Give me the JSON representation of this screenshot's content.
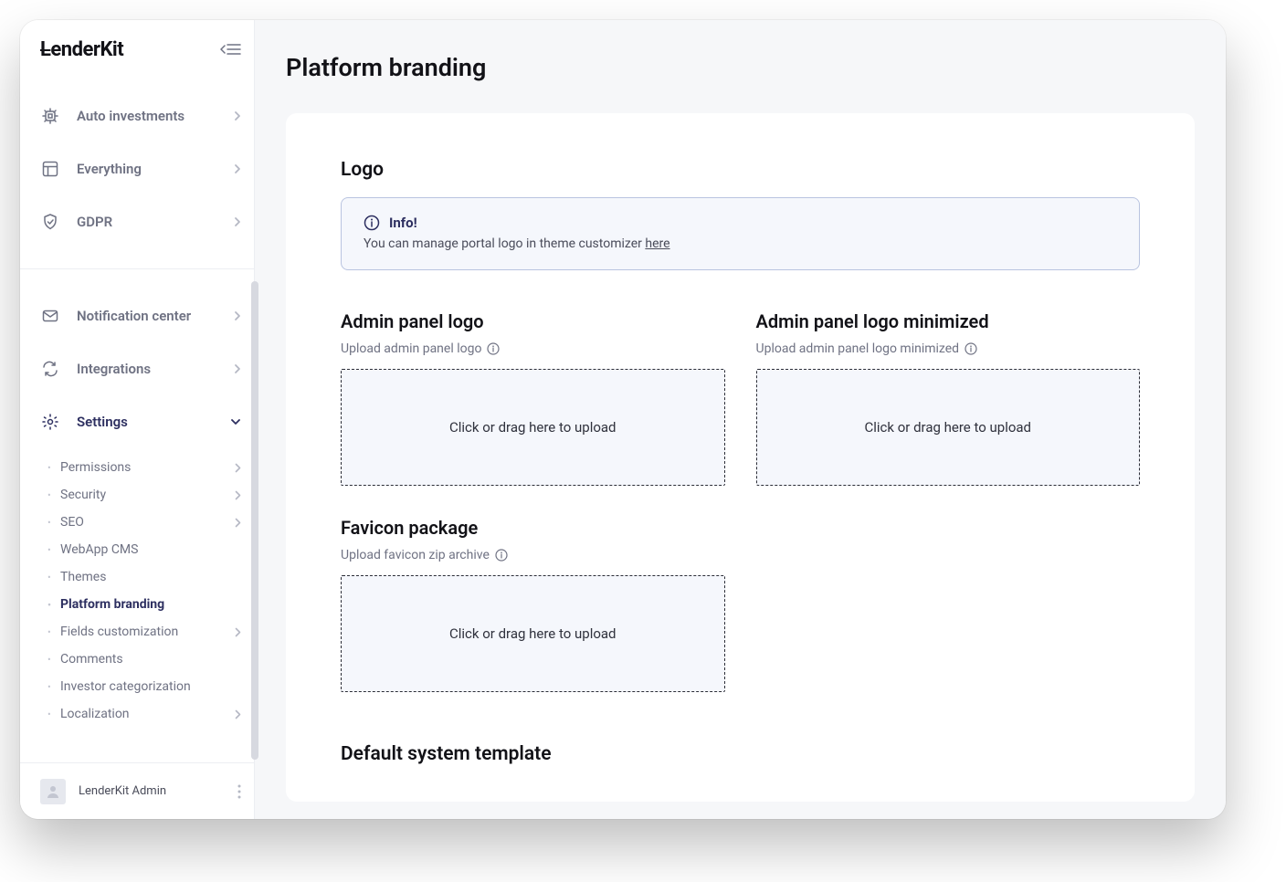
{
  "brand": "LenderKit",
  "page_title": "Platform branding",
  "sidebar": {
    "nav": [
      {
        "label": "Auto investments",
        "icon": "auto-investments"
      },
      {
        "label": "Everything",
        "icon": "everything"
      },
      {
        "label": "GDPR",
        "icon": "gdpr"
      }
    ],
    "nav2": [
      {
        "label": "Notification center",
        "icon": "notification"
      },
      {
        "label": "Integrations",
        "icon": "integrations"
      },
      {
        "label": "Settings",
        "icon": "settings",
        "active": true,
        "expanded": true
      }
    ],
    "settings_sub": [
      {
        "label": "Permissions",
        "chevron": true
      },
      {
        "label": "Security",
        "chevron": true
      },
      {
        "label": "SEO",
        "chevron": true
      },
      {
        "label": "WebApp CMS",
        "chevron": false
      },
      {
        "label": "Themes",
        "chevron": false
      },
      {
        "label": "Platform branding",
        "chevron": false,
        "selected": true
      },
      {
        "label": "Fields customization",
        "chevron": true
      },
      {
        "label": "Comments",
        "chevron": false
      },
      {
        "label": "Investor categorization",
        "chevron": false
      },
      {
        "label": "Localization",
        "chevron": true
      }
    ]
  },
  "user": {
    "name": "LenderKit Admin"
  },
  "logo_section": {
    "title": "Logo",
    "info_title": "Info!",
    "info_text": "You can manage portal logo in theme customizer ",
    "info_link": "here"
  },
  "uploads": {
    "admin_logo": {
      "title": "Admin panel logo",
      "subtitle": "Upload admin panel logo",
      "dropzone": "Click or drag here to upload"
    },
    "admin_logo_min": {
      "title": "Admin panel logo minimized",
      "subtitle": "Upload admin panel logo minimized",
      "dropzone": "Click or drag here to upload"
    },
    "favicon": {
      "title": "Favicon package",
      "subtitle": "Upload favicon zip archive",
      "dropzone": "Click or drag here to upload"
    }
  },
  "template_section_title": "Default system template"
}
